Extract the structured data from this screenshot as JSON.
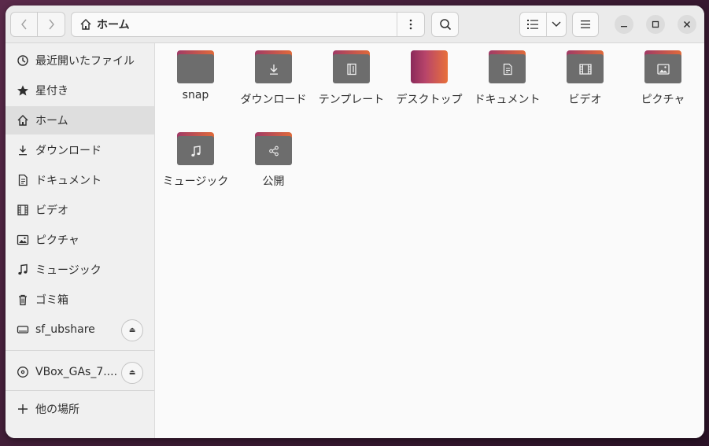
{
  "pathbar": {
    "current_location": "ホーム"
  },
  "sidebar": {
    "items": [
      {
        "label": "最近開いたファイル",
        "icon": "clock-icon"
      },
      {
        "label": "星付き",
        "icon": "star-icon"
      },
      {
        "label": "ホーム",
        "icon": "home-icon",
        "active": true
      },
      {
        "label": "ダウンロード",
        "icon": "download-icon"
      },
      {
        "label": "ドキュメント",
        "icon": "document-icon"
      },
      {
        "label": "ビデオ",
        "icon": "film-icon"
      },
      {
        "label": "ピクチャ",
        "icon": "picture-icon"
      },
      {
        "label": "ミュージック",
        "icon": "music-icon"
      },
      {
        "label": "ゴミ箱",
        "icon": "trash-icon"
      }
    ],
    "devices": [
      {
        "label": "sf_ubshare",
        "icon": "drive-icon"
      },
      {
        "label": "VBox_GAs_7....",
        "icon": "disc-icon"
      }
    ],
    "other_locations": "他の場所"
  },
  "files": [
    {
      "name": "snap",
      "icon": "folder-icon"
    },
    {
      "name": "ダウンロード",
      "icon": "download-folder-icon"
    },
    {
      "name": "テンプレート",
      "icon": "template-folder-icon"
    },
    {
      "name": "デスクトップ",
      "icon": "desktop-folder-icon"
    },
    {
      "name": "ドキュメント",
      "icon": "document-folder-icon"
    },
    {
      "name": "ビデオ",
      "icon": "video-folder-icon"
    },
    {
      "name": "ピクチャ",
      "icon": "picture-folder-icon"
    },
    {
      "name": "ミュージック",
      "icon": "music-folder-icon"
    },
    {
      "name": "公開",
      "icon": "share-folder-icon"
    }
  ]
}
